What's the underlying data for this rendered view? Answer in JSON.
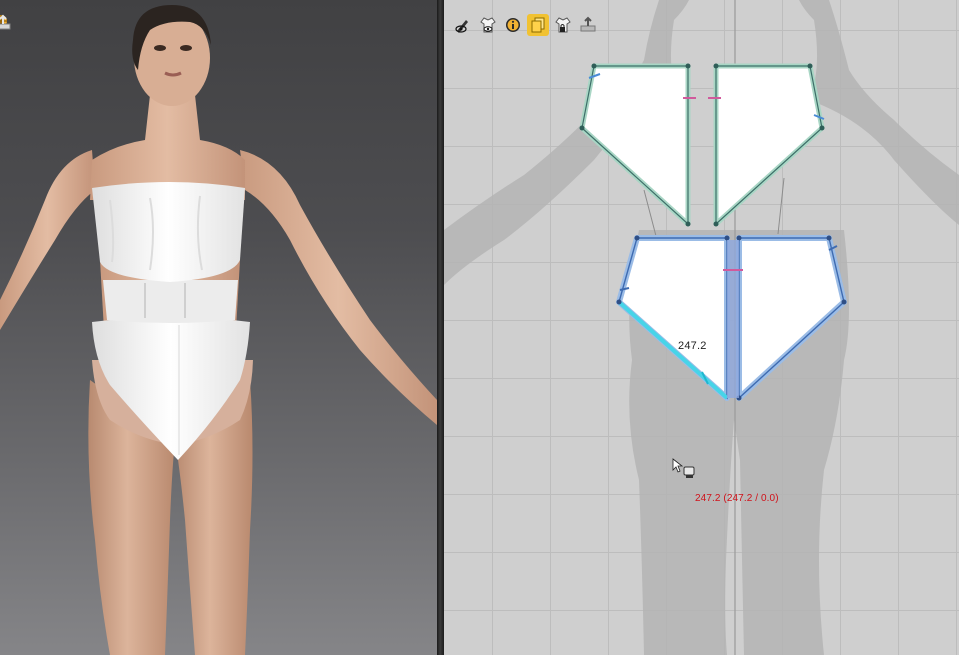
{
  "viewport_3d": {
    "toolbar": {
      "icons": [
        "globe-icon",
        "export-icon"
      ]
    }
  },
  "pattern_window": {
    "toolbar": {
      "icons": [
        "pen-eye-icon",
        "garment-eye-icon",
        "info-icon",
        "pattern-copy-icon",
        "garment-lock-icon",
        "export-icon"
      ],
      "active_index": 3
    },
    "segment_label": "247.2",
    "measurement_readout": "247.2 (247.2 / 0.0)",
    "colors": {
      "selected_outline": "#4a8bd6",
      "selected_edge": "#47d4e8",
      "unselected_outline": "#9fd0bf",
      "notch_pink": "#d05a9c",
      "readout": "#d0121a"
    }
  }
}
